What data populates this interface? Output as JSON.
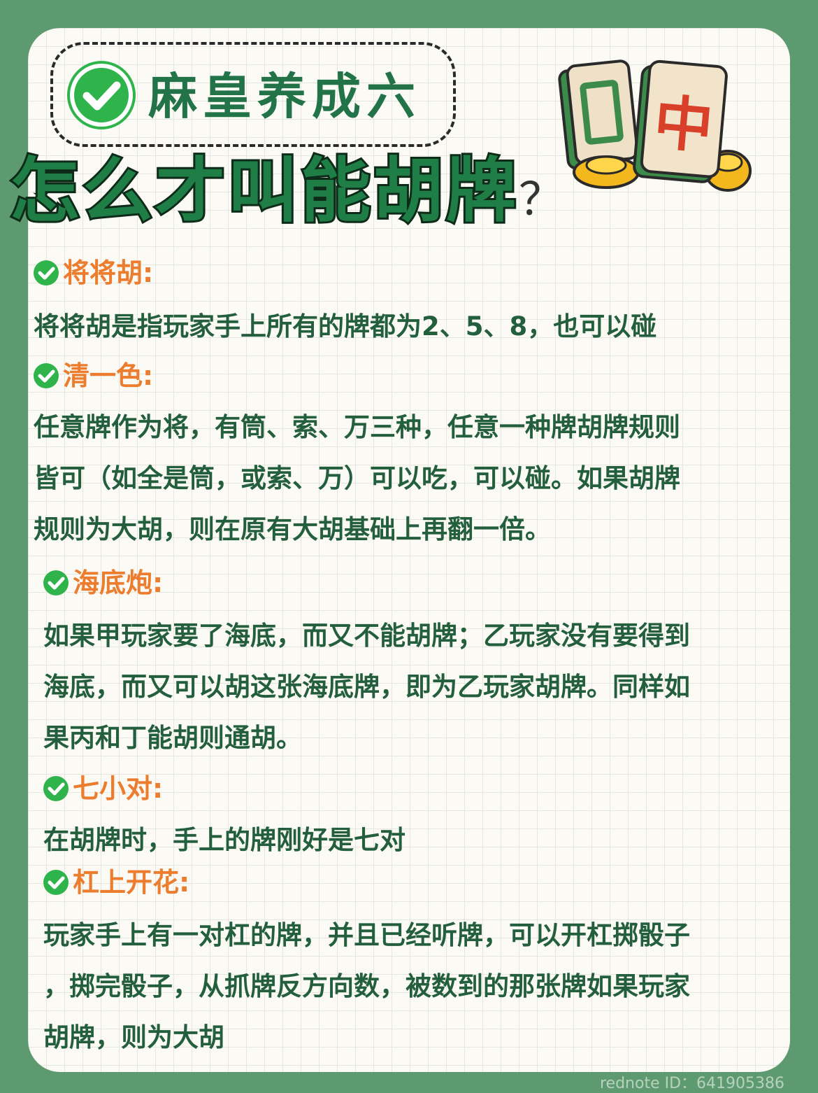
{
  "badge": {
    "text": "麻皇养成六",
    "icon": "check-circle-icon"
  },
  "title": {
    "main": "怎么才叫能胡牌",
    "question_mark": "？"
  },
  "illustration": {
    "tile_character": "中",
    "icon": "mahjong-tiles-gold-ingots"
  },
  "sections": [
    {
      "heading": "将将胡:",
      "lines": [
        "将将胡是指玩家手上所有的牌都为2、5、8，也可以碰"
      ]
    },
    {
      "heading": "清一色:",
      "lines": [
        "任意牌作为将，有筒、索、万三种，任意一种牌胡牌规则",
        "皆可（如全是筒，或索、万）可以吃，可以碰。如果胡牌",
        "规则为大胡，则在原有大胡基础上再翻一倍。"
      ]
    },
    {
      "heading": "海底炮:",
      "lines": [
        "如果甲玩家要了海底，而又不能胡牌；乙玩家没有要得到",
        "海底，而又可以胡这张海底牌，即为乙玩家胡牌。同样如",
        "果丙和丁能胡则通胡。"
      ]
    },
    {
      "heading": "七小对:",
      "lines": [
        "在胡牌时，手上的牌刚好是七对"
      ]
    },
    {
      "heading": "杠上开花:",
      "lines": [
        "玩家手上有一对杠的牌，并且已经听牌，可以开杠掷骰子",
        "，掷完骰子，从抓牌反方向数，被数到的那张牌如果玩家",
        "胡牌，则为大胡"
      ]
    }
  ],
  "watermark": "rednote ID：641905386",
  "colors": {
    "background": "#5e9a70",
    "accent_green": "#2fb44c",
    "heading_orange": "#ec7d2f",
    "body_text": "#235e3d"
  }
}
